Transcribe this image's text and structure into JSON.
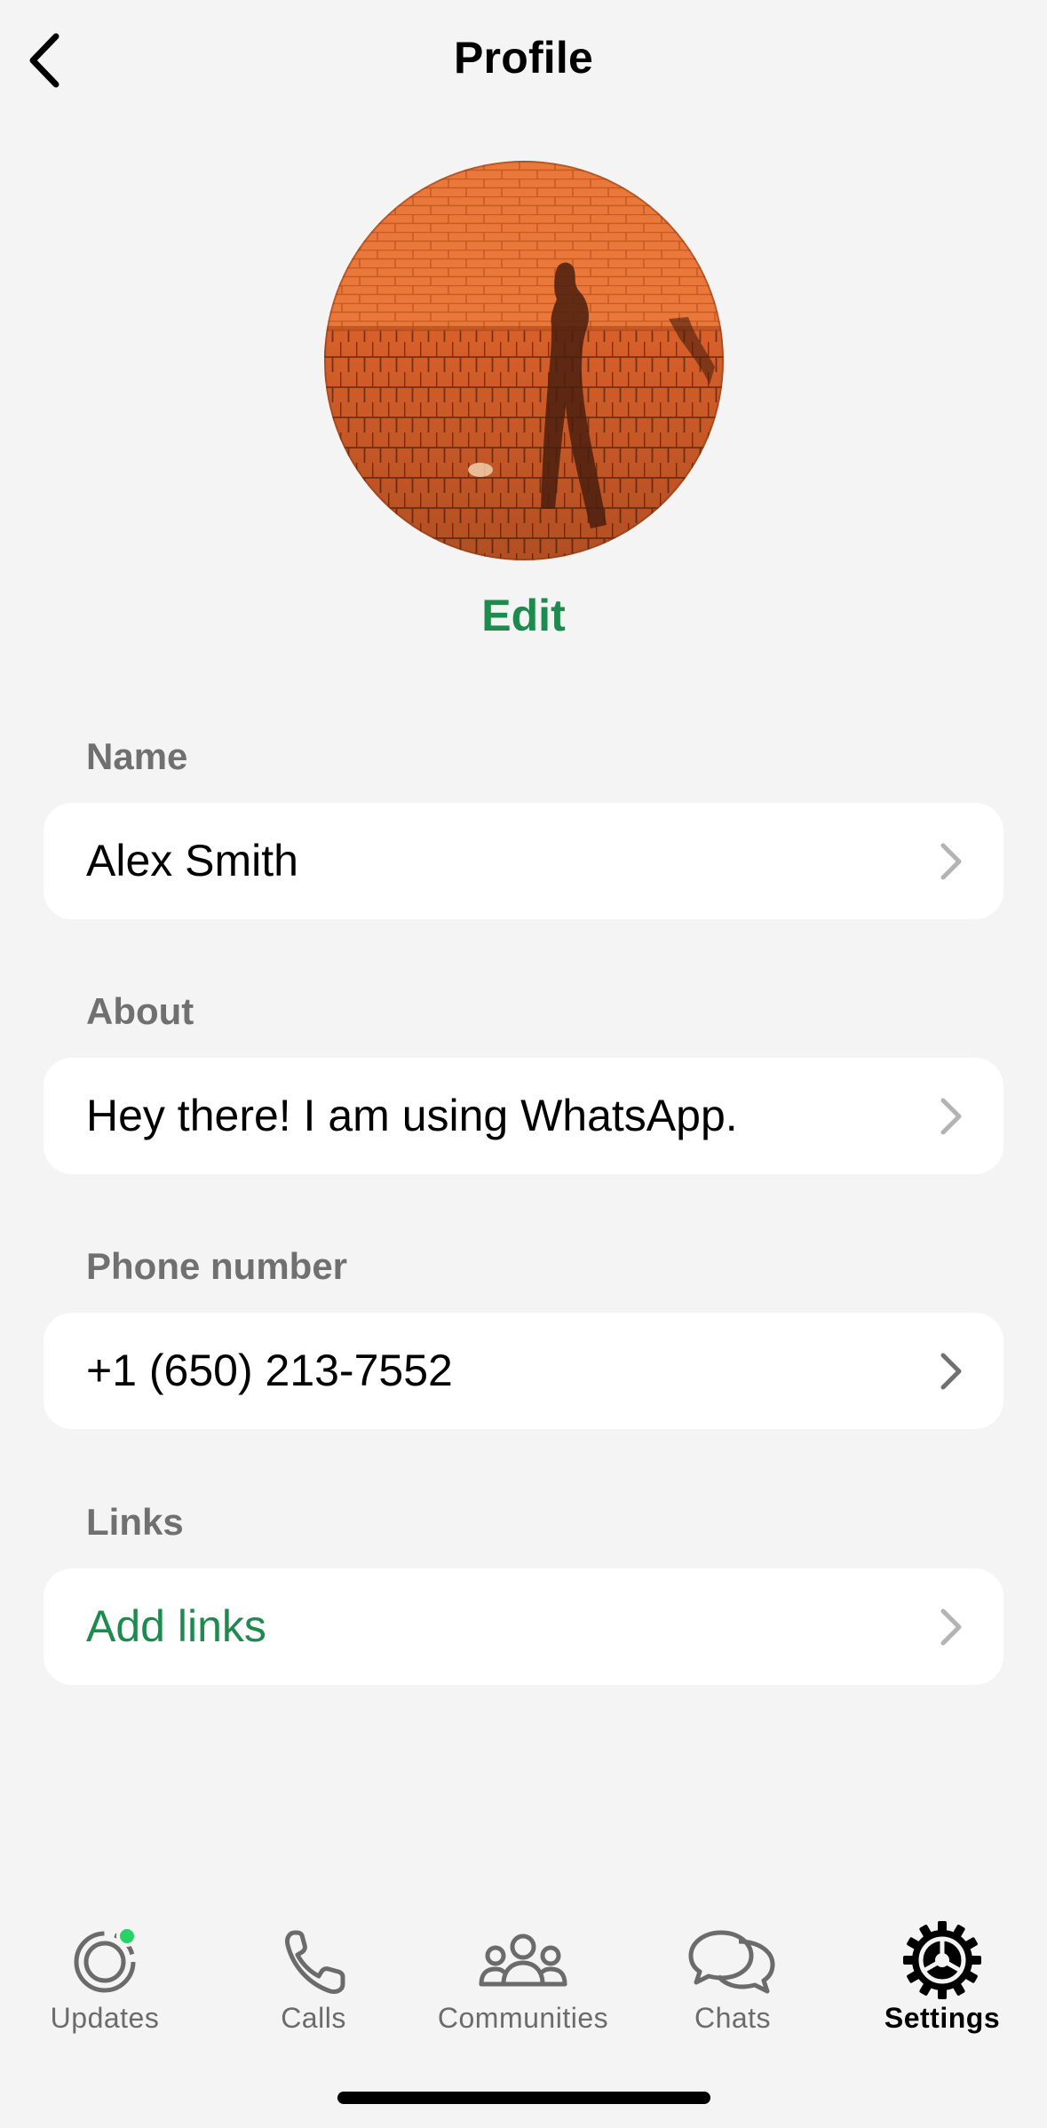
{
  "header": {
    "title": "Profile",
    "back_icon": "chevron-left-icon"
  },
  "profile": {
    "edit_label": "Edit"
  },
  "sections": [
    {
      "label": "Name",
      "value": "Alex Smith"
    },
    {
      "label": "About",
      "value": "Hey there! I am using WhatsApp."
    },
    {
      "label": "Phone number",
      "value": "+1 (650) 213-7552"
    },
    {
      "label": "Links",
      "value": "Add links"
    }
  ],
  "tabbar": {
    "tabs": [
      {
        "label": "Updates",
        "icon": "updates-icon",
        "active": false,
        "badge_dot": true
      },
      {
        "label": "Calls",
        "icon": "phone-icon",
        "active": false
      },
      {
        "label": "Communities",
        "icon": "communities-icon",
        "active": false
      },
      {
        "label": "Chats",
        "icon": "chats-icon",
        "active": false
      },
      {
        "label": "Settings",
        "icon": "gear-icon",
        "active": true
      }
    ]
  },
  "colors": {
    "accent": "#1d8a4e",
    "background": "#f4f4f4",
    "card": "#ffffff",
    "label_gray": "#707070",
    "badge": "#25d366"
  }
}
